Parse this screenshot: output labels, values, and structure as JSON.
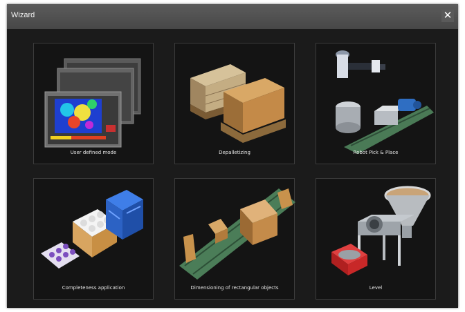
{
  "window": {
    "title": "Wizard",
    "close_icon": "close-icon"
  },
  "tiles": [
    {
      "label": "User defined mode",
      "icon": "screens-icon"
    },
    {
      "label": "Depalletizing",
      "icon": "pallet-boxes-icon"
    },
    {
      "label": "Robot Pick & Place",
      "icon": "robot-arm-icon"
    },
    {
      "label": "Completeness application",
      "icon": "crates-icon"
    },
    {
      "label": "Dimensioning of rectangular objects",
      "icon": "conveyor-boxes-icon"
    },
    {
      "label": "Level",
      "icon": "hopper-icon"
    }
  ]
}
